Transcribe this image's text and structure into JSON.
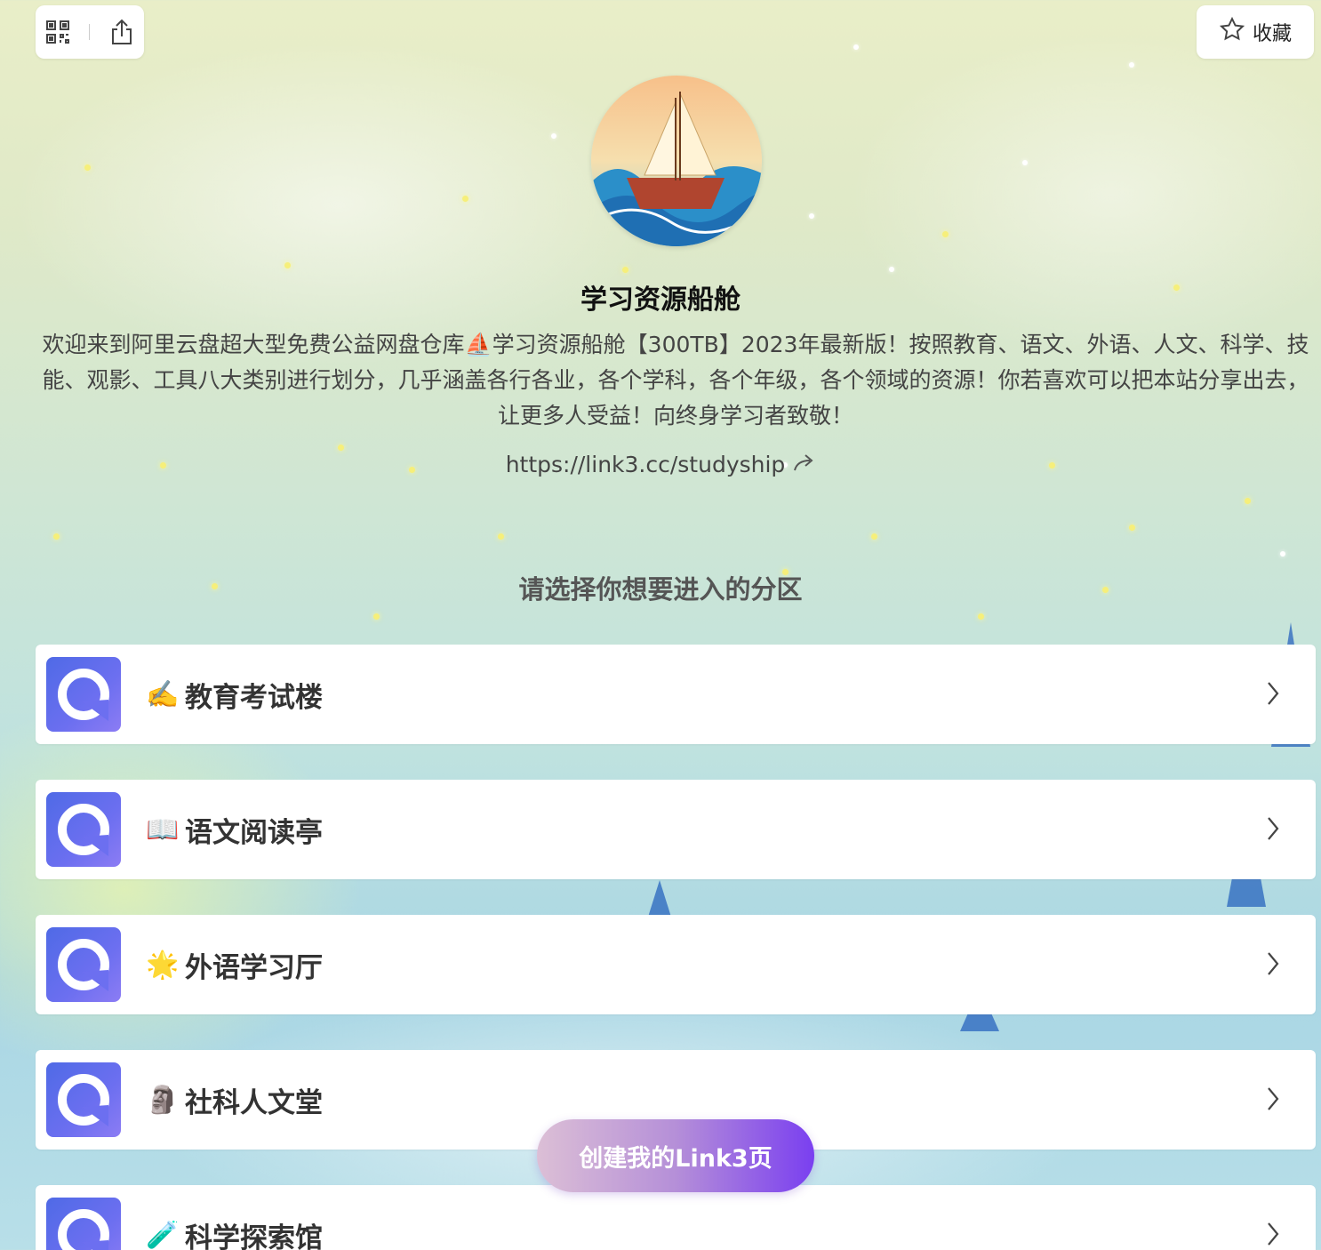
{
  "topbar": {
    "qr_icon": "qr-code-icon",
    "share_icon": "share-icon",
    "favorite": {
      "icon": "star-outline-icon",
      "label": "收藏"
    }
  },
  "profile": {
    "avatar": "sailing-ship-illustration",
    "name": "学习资源船舱",
    "description": "欢迎来到阿里云盘超大型免费公益网盘仓库⛵学习资源船舱【300TB】2023年最新版！按照教育、语文、外语、人文、科学、技能、观影、工具八大类别进行划分，几乎涵盖各行各业，各个学科，各个年级，各个领域的资源！你若喜欢可以把本站分享出去，让更多人受益！向终身学习者致敬！",
    "link": "https://link3.cc/studyship",
    "link_icon": "share-arrow-icon"
  },
  "section_title": "请选择你想要进入的分区",
  "items": [
    {
      "emoji": "✍️",
      "label": "教育考试楼",
      "icon": "aliyun-drive-icon"
    },
    {
      "emoji": "📖",
      "label": "语文阅读亭",
      "icon": "aliyun-drive-icon"
    },
    {
      "emoji": "🌟",
      "label": "外语学习厅",
      "icon": "aliyun-drive-icon"
    },
    {
      "emoji": "🗿",
      "label": "社科人文堂",
      "icon": "aliyun-drive-icon"
    },
    {
      "emoji": "🧪",
      "label": "科学探索馆",
      "icon": "aliyun-drive-icon"
    }
  ],
  "cta": {
    "label": "创建我的Link3页"
  },
  "colors": {
    "accent_start": "#dcbfd6",
    "accent_end": "#7a3ff0",
    "logo_blue": "#5b6cec"
  }
}
